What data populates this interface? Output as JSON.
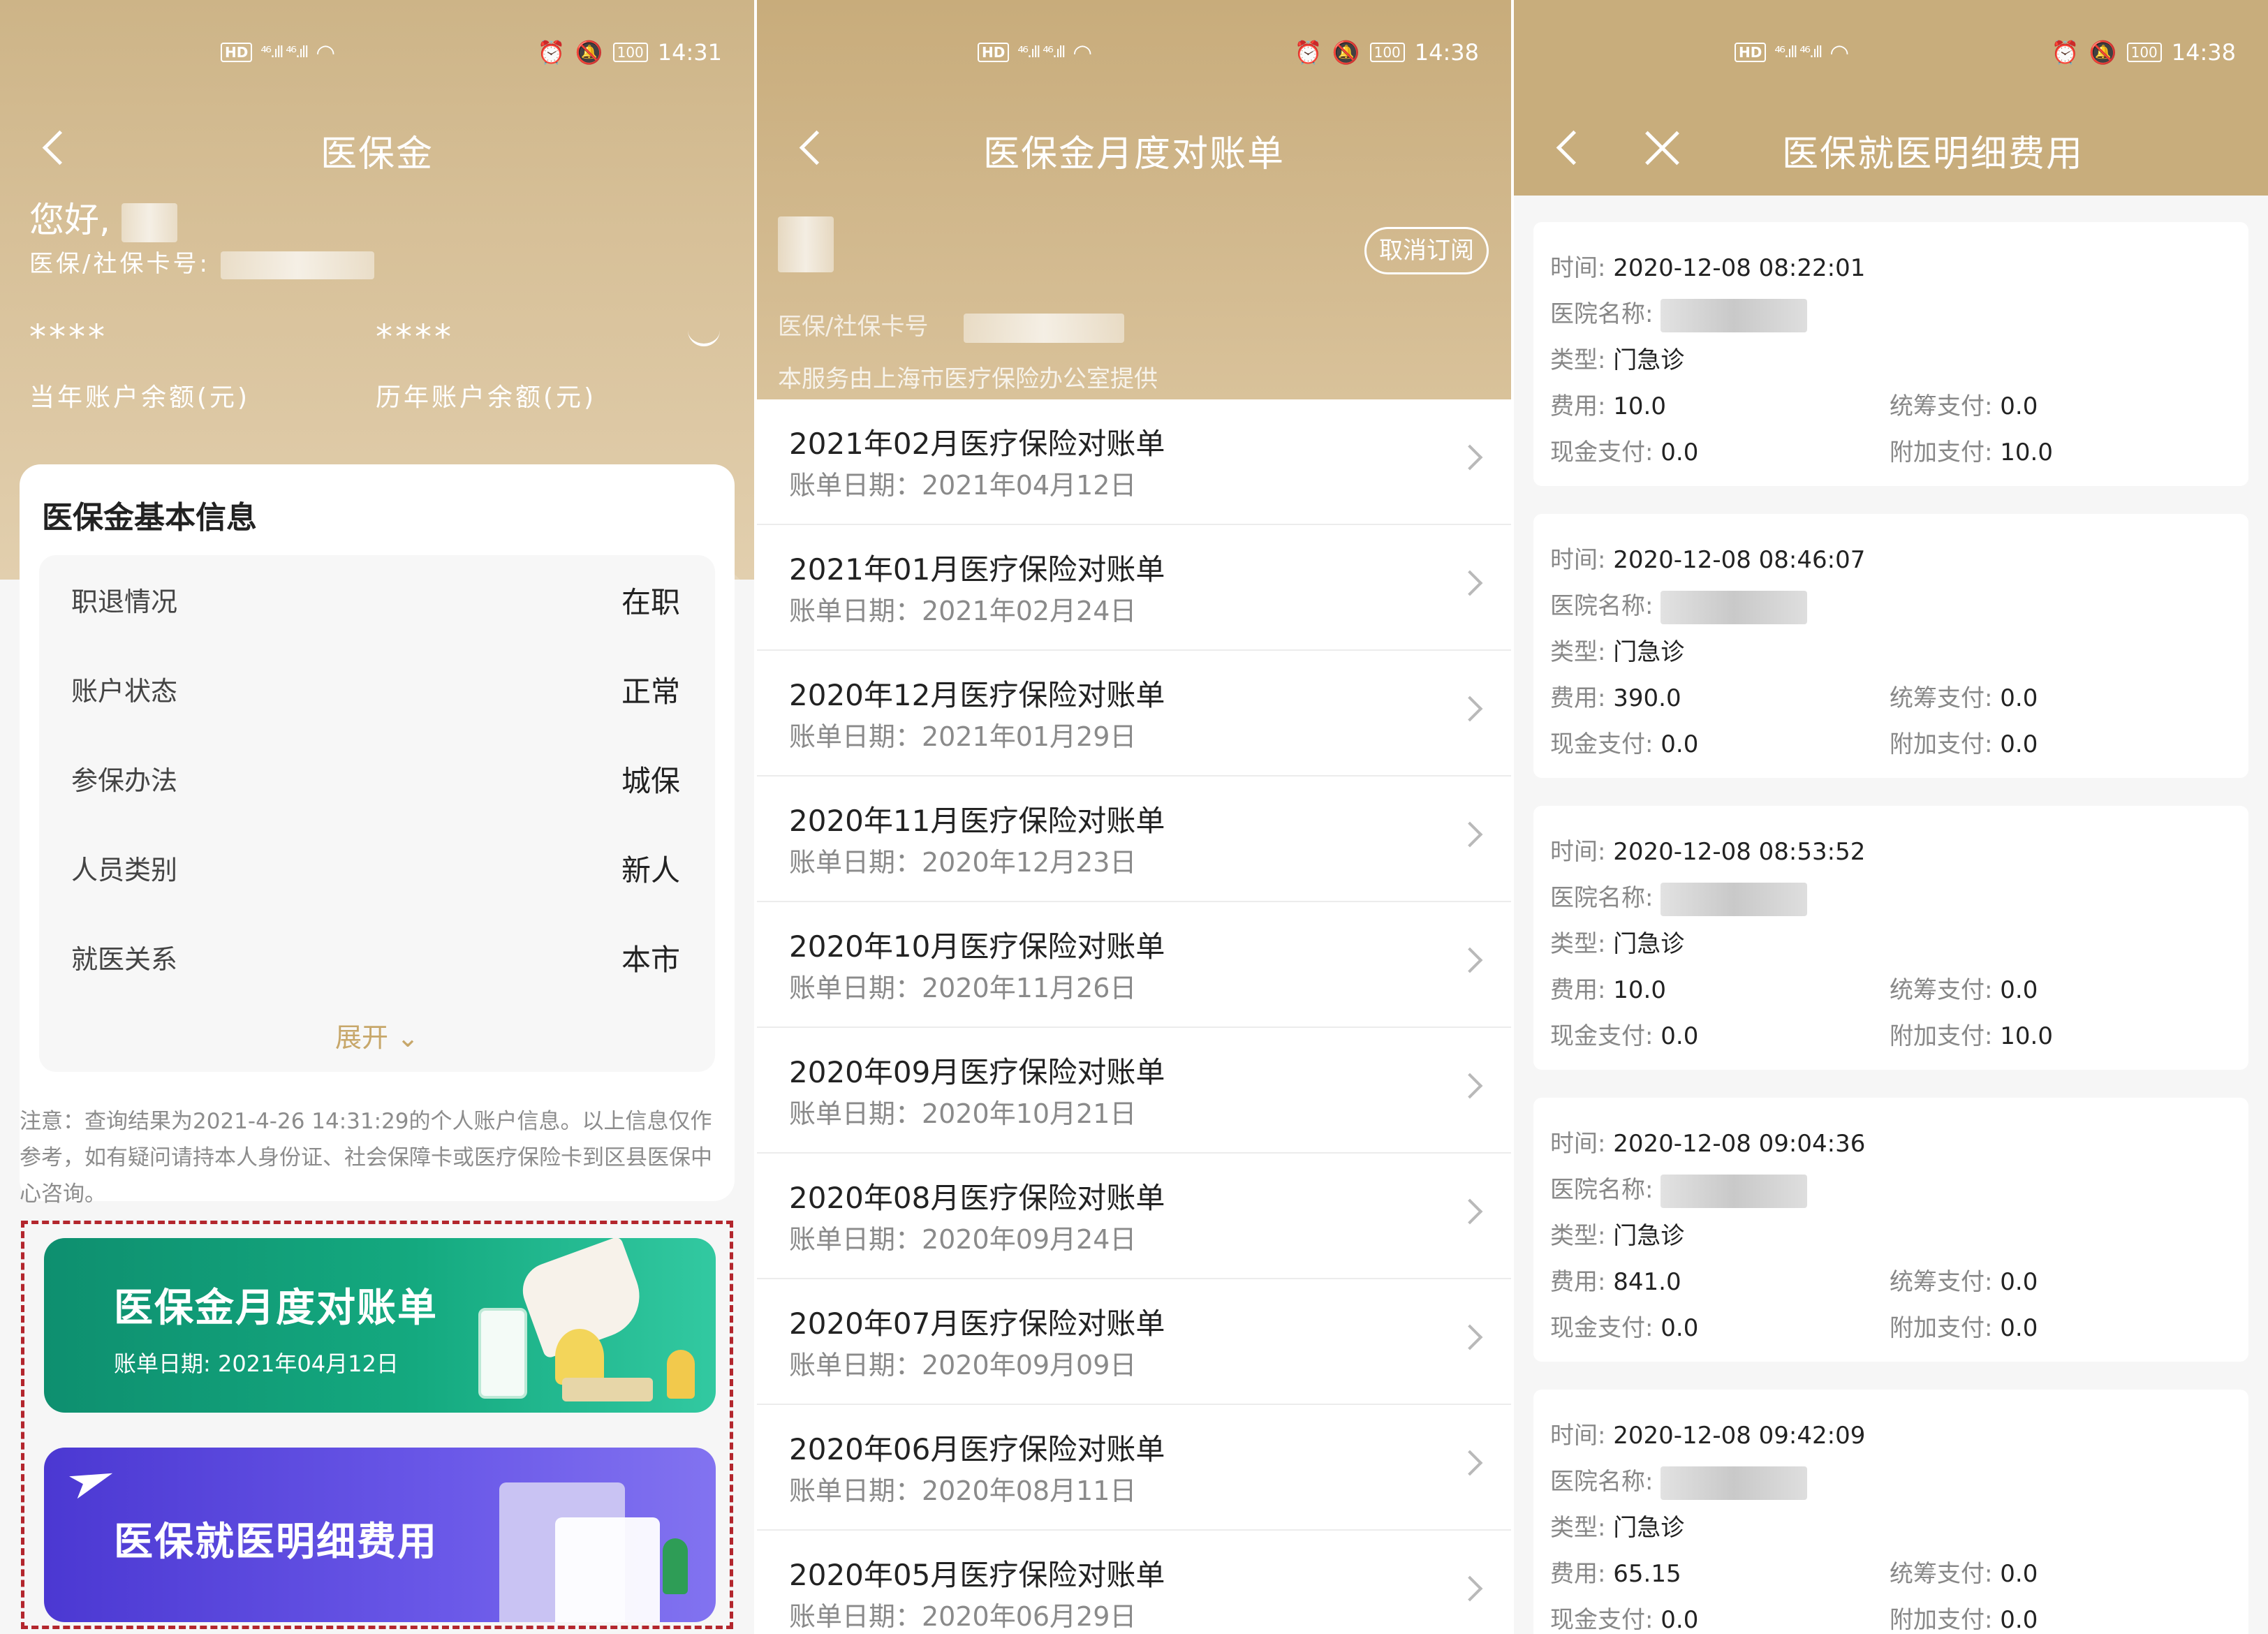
{
  "status": [
    {
      "time": "14:31",
      "battery": "100"
    },
    {
      "time": "14:38",
      "battery": "100"
    },
    {
      "time": "14:38",
      "battery": "100"
    }
  ],
  "status_icons": {
    "hd": "HD",
    "signal": "⁴⁶.ıll ⁴⁶.ıll",
    "wifi": "wifi-icon",
    "alarm": "⏰",
    "mute": "🔕"
  },
  "panel1": {
    "title": "医保金",
    "greeting": "您好,",
    "card_label": "医保/社保卡号:",
    "current_balance_mask": "****",
    "current_balance_label": "当年账户余额(元)",
    "history_balance_mask": "****",
    "history_balance_label": "历年账户余额(元)",
    "info_title": "医保金基本信息",
    "info_rows": [
      {
        "label": "职退情况",
        "value": "在职"
      },
      {
        "label": "账户状态",
        "value": "正常"
      },
      {
        "label": "参保办法",
        "value": "城保"
      },
      {
        "label": "人员类别",
        "value": "新人"
      },
      {
        "label": "就医关系",
        "value": "本市"
      }
    ],
    "expand_label": "展开",
    "notice": "注意：查询结果为2021-4-26 14:31:29的个人账户信息。以上信息仅作参考，如有疑问请持本人身份证、社会保障卡或医疗保险卡到区县医保中心咨询。",
    "banner1_title": "医保金月度对账单",
    "banner1_sub": "账单日期: 2021年04月12日",
    "banner2_title": "医保就医明细费用"
  },
  "panel2": {
    "title": "医保金月度对账单",
    "unsubscribe": "取消订阅",
    "card_label": "医保/社保卡号",
    "provider": "本服务由上海市医疗保险办公室提供",
    "bills": [
      {
        "title": "2021年02月医疗保险对账单",
        "date": "账单日期：2021年04月12日"
      },
      {
        "title": "2021年01月医疗保险对账单",
        "date": "账单日期：2021年02月24日"
      },
      {
        "title": "2020年12月医疗保险对账单",
        "date": "账单日期：2021年01月29日"
      },
      {
        "title": "2020年11月医疗保险对账单",
        "date": "账单日期：2020年12月23日"
      },
      {
        "title": "2020年10月医疗保险对账单",
        "date": "账单日期：2020年11月26日"
      },
      {
        "title": "2020年09月医疗保险对账单",
        "date": "账单日期：2020年10月21日"
      },
      {
        "title": "2020年08月医疗保险对账单",
        "date": "账单日期：2020年09月24日"
      },
      {
        "title": "2020年07月医疗保险对账单",
        "date": "账单日期：2020年09月09日"
      },
      {
        "title": "2020年06月医疗保险对账单",
        "date": "账单日期：2020年08月11日"
      },
      {
        "title": "2020年05月医疗保险对账单",
        "date": "账单日期：2020年06月29日"
      }
    ]
  },
  "panel3": {
    "title": "医保就医明细费用",
    "labels": {
      "time": "时间: ",
      "hospital": "医院名称: ",
      "type": "类型: ",
      "fee": "费用: ",
      "pooled": "统筹支付: ",
      "cash": "现金支付: ",
      "extra": "附加支付: "
    },
    "records": [
      {
        "time": "2020-12-08 08:22:01",
        "type": "门急诊",
        "fee": "10.0",
        "pooled": "0.0",
        "cash": "0.0",
        "extra": "10.0"
      },
      {
        "time": "2020-12-08 08:46:07",
        "type": "门急诊",
        "fee": "390.0",
        "pooled": "0.0",
        "cash": "0.0",
        "extra": "0.0"
      },
      {
        "time": "2020-12-08 08:53:52",
        "type": "门急诊",
        "fee": "10.0",
        "pooled": "0.0",
        "cash": "0.0",
        "extra": "10.0"
      },
      {
        "time": "2020-12-08 09:04:36",
        "type": "门急诊",
        "fee": "841.0",
        "pooled": "0.0",
        "cash": "0.0",
        "extra": "0.0"
      },
      {
        "time": "2020-12-08 09:42:09",
        "type": "门急诊",
        "fee": "65.15",
        "pooled": "0.0",
        "cash": "0.0",
        "extra": "0.0"
      }
    ]
  },
  "colors": {
    "gold": "#c8ad7c",
    "green": "#14a97f",
    "purple": "#5a47dc",
    "dash": "#b3262d",
    "accent_text": "#c7a76a"
  }
}
